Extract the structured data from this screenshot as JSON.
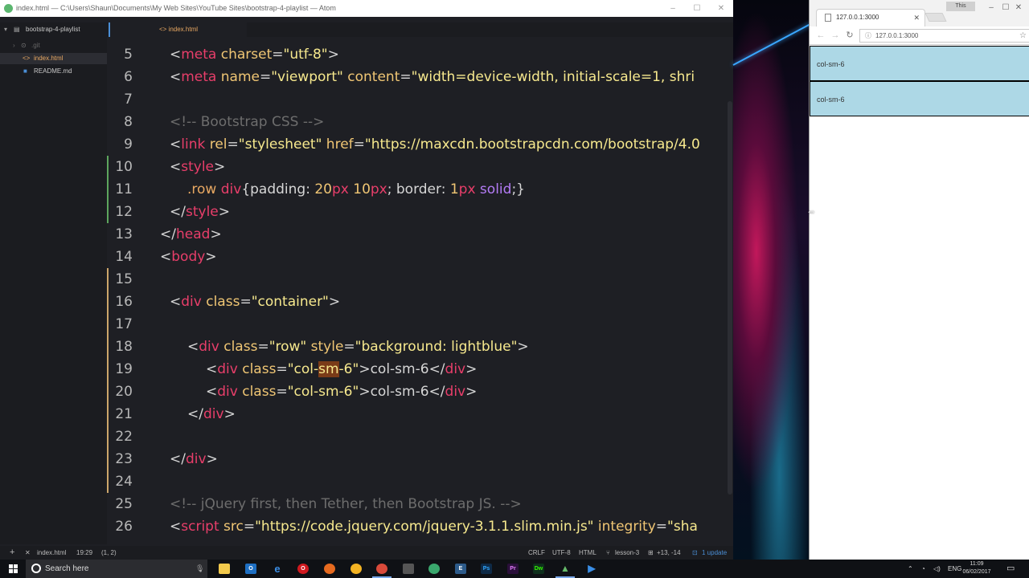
{
  "atom": {
    "title": "index.html — C:\\Users\\Shaun\\Documents\\My Web Sites\\YouTube Sites\\bootstrap-4-playlist — Atom",
    "window_controls": [
      "–",
      "☐",
      "✕"
    ],
    "tree": {
      "project": "bootstrap-4-playlist",
      "items": [
        {
          "label": ".git",
          "icon": "repo-icon"
        },
        {
          "label": "index.html",
          "icon": "code-file-icon"
        },
        {
          "label": "README.md",
          "icon": "book-icon"
        }
      ]
    },
    "tab": "index.html",
    "editor": {
      "line_numbers": [
        "5",
        "6",
        "7",
        "8",
        "9",
        "10",
        "11",
        "12",
        "13",
        "14",
        "15",
        "16",
        "17",
        "18",
        "19",
        "20",
        "21",
        "22",
        "23",
        "24",
        "25",
        "26"
      ],
      "lines": {
        "l5": {
          "open": "<",
          "tag": "meta",
          "attr": " charset",
          "eq": "=",
          "val": "\"utf-8\"",
          "close": ">"
        },
        "l6": {
          "open": "<",
          "tag": "meta",
          "attr1": " name",
          "eq1": "=",
          "val1": "\"viewport\"",
          "attr2": " content",
          "eq2": "=",
          "val2": "\"width=device-width, initial-scale=1, shri"
        },
        "l8": "<!-- Bootstrap CSS -->",
        "l9": {
          "open": "<",
          "tag": "link",
          "attr1": " rel",
          "eq1": "=",
          "val1": "\"stylesheet\"",
          "attr2": " href",
          "eq2": "=",
          "val2": "\"https://maxcdn.bootstrapcdn.com/bootstrap/4.0"
        },
        "l10": {
          "open": "<",
          "tag": "style",
          "close": ">"
        },
        "l11": {
          "sel1": ".row",
          "sel2": " div",
          "brace": "{padding: ",
          "n1": "20",
          "u1": "px",
          "sp": " ",
          "n2": "10",
          "u2": "px",
          "mid": "; border: ",
          "n3": "1",
          "u3": "px",
          "kw": " solid",
          "end": ";}"
        },
        "l12": {
          "open": "</",
          "tag": "style",
          "close": ">"
        },
        "l13": {
          "open": "</",
          "tag": "head",
          "close": ">"
        },
        "l14": {
          "open": "<",
          "tag": "body",
          "close": ">"
        },
        "l16": {
          "open": "<",
          "tag": "div",
          "attr": " class",
          "eq": "=",
          "val": "\"container\"",
          "close": ">"
        },
        "l18": {
          "open": "<",
          "tag": "div",
          "attr1": " class",
          "eq1": "=",
          "val1": "\"row\"",
          "attr2": " style",
          "eq2": "=",
          "val2": "\"background: lightblue\"",
          "close": ">"
        },
        "l19": {
          "open": "<",
          "tag": "div",
          "attr": " class",
          "eq": "=",
          "val_a": "\"col-",
          "val_hl": "sm",
          "val_b": "-6\"",
          "close": ">",
          "text": "col-sm-6",
          "cl_open": "</",
          "cl_tag": "div",
          "cl_close": ">"
        },
        "l20": {
          "open": "<",
          "tag": "div",
          "attr": " class",
          "eq": "=",
          "val": "\"col-sm-6\"",
          "close": ">",
          "text": "col-sm-6",
          "cl_open": "</",
          "cl_tag": "div",
          "cl_close": ">"
        },
        "l21": {
          "open": "</",
          "tag": "div",
          "close": ">"
        },
        "l23": {
          "open": "</",
          "tag": "div",
          "close": ">"
        },
        "l25": "<!-- jQuery first, then Tether, then Bootstrap JS. -->",
        "l26": {
          "open": "<",
          "tag": "script",
          "attr1": " src",
          "eq1": "=",
          "val1": "\"https://code.jquery.com/jquery-3.1.1.slim.min.js\"",
          "attr2": " integrity",
          "eq2": "=",
          "val2": "\"sha"
        }
      }
    },
    "status": {
      "add": "+",
      "close": "✕",
      "file": "index.html",
      "cursor": "19:29",
      "selection": "(1, 2)",
      "line_ending": "CRLF",
      "encoding": "UTF-8",
      "grammar": "HTML",
      "branch": "lesson-3",
      "diff": "+13, -14",
      "updates": "1 update"
    }
  },
  "chrome": {
    "profile": "This",
    "tab_title": "127.0.0.1:3000",
    "url": "127.0.0.1:3000",
    "window_controls": [
      "–",
      "☐",
      "✕"
    ],
    "page": {
      "boxes": [
        "col-sm-6",
        "col-sm-6"
      ]
    }
  },
  "taskbar": {
    "search_placeholder": "Search here",
    "apps": [
      "file-explorer",
      "outlook",
      "edge",
      "opera",
      "firefox",
      "chrome-canary",
      "chrome",
      "virtualbox",
      "atom-green",
      "visual-studio",
      "photoshop",
      "premiere",
      "dreamweaver",
      "atom",
      "powershell"
    ],
    "language": "ENG",
    "time": "11:09",
    "date": "06/02/2017"
  }
}
